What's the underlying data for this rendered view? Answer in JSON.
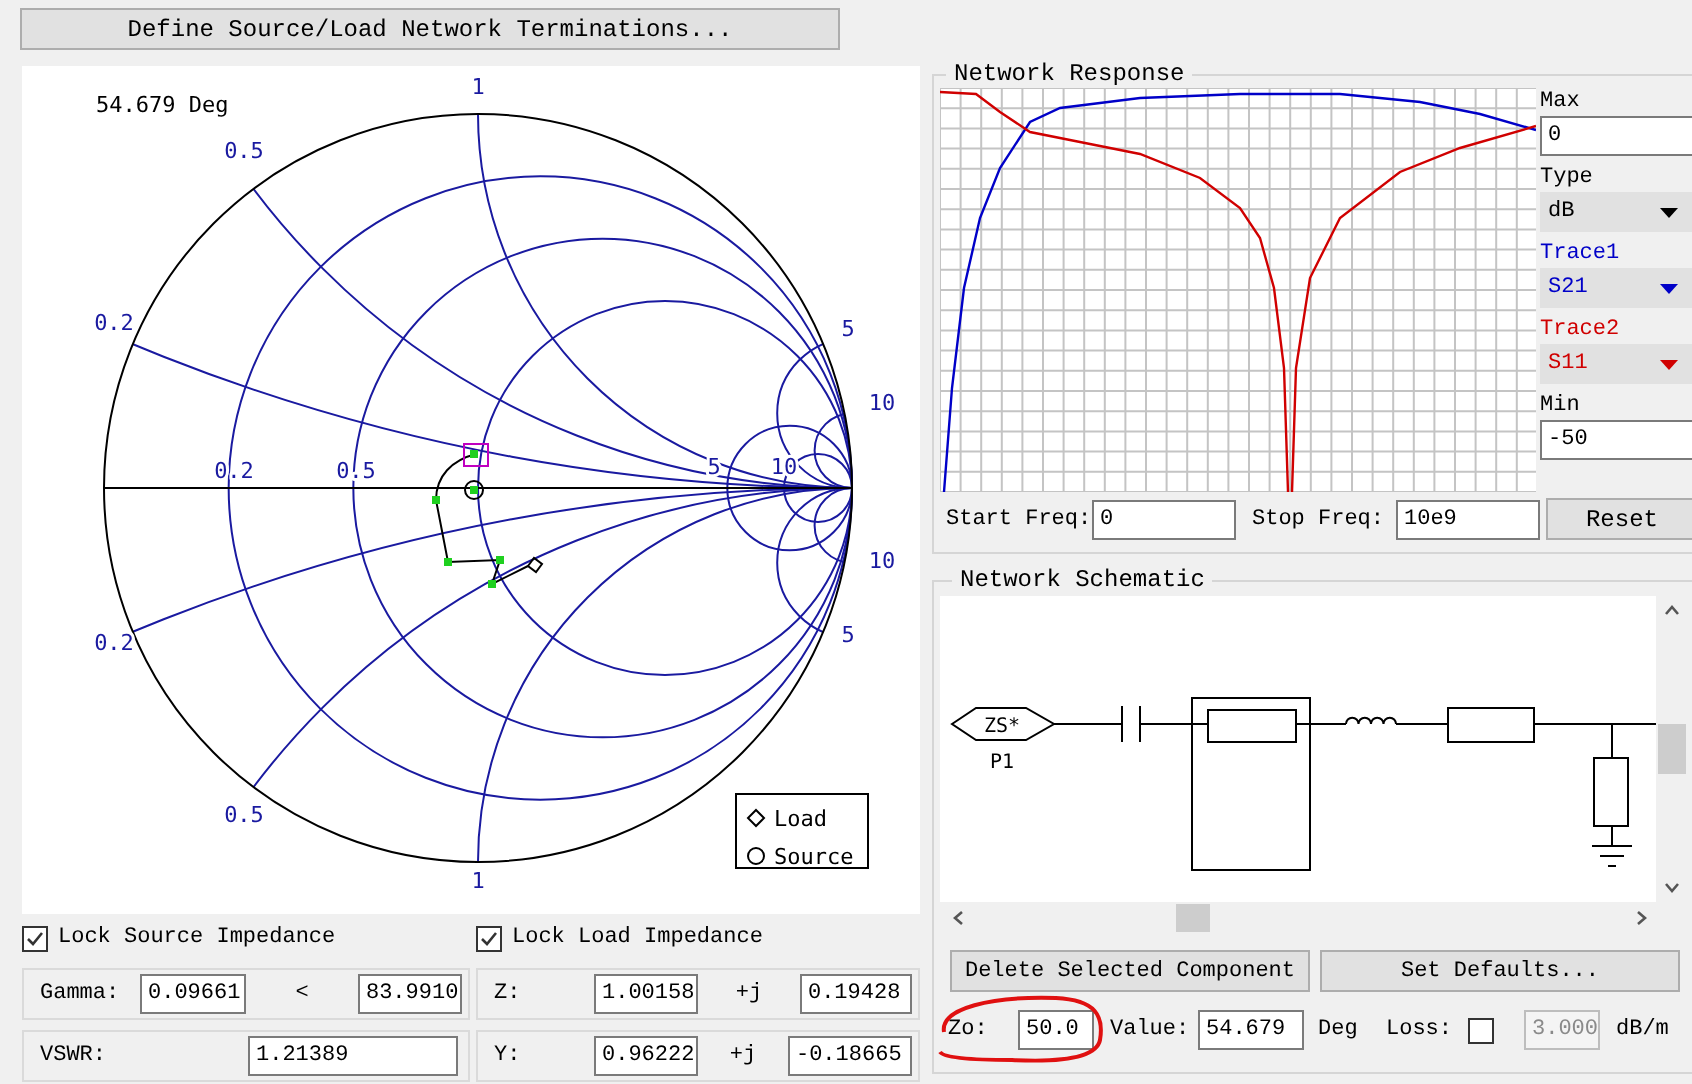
{
  "toolbar_button": "Define Source/Load Network Terminations...",
  "smith_chart": {
    "angle_readout": "54.679 Deg",
    "labels": [
      "1",
      "0.5",
      "0.2",
      "5",
      "10",
      "0.2",
      "0.5",
      "5",
      "10",
      "10",
      "5",
      "0.2",
      "0.5",
      "1"
    ],
    "legend": [
      {
        "kind": "diamond",
        "label": "Load"
      },
      {
        "kind": "circle",
        "label": "Source"
      }
    ]
  },
  "source": {
    "lock": {
      "label": "Lock Source Impedance",
      "checked": true
    },
    "gamma_label": "Gamma:",
    "gamma_mag": "0.09661",
    "angle_symbol": "<",
    "gamma_angle": "83.9910",
    "vswr_label": "VSWR:",
    "vswr": "1.21389"
  },
  "load": {
    "lock": {
      "label": "Lock Load Impedance",
      "checked": true
    },
    "z_label": "Z:",
    "z_real": "1.00158",
    "z_j": "+j",
    "z_imag": "0.19428",
    "y_label": "Y:",
    "y_real": "0.96222",
    "y_j": "+j",
    "y_imag": "-0.18665"
  },
  "network_response": {
    "title": "Network Response",
    "max_label": "Max",
    "max": "0",
    "type_label": "Type",
    "type": "dB",
    "traces": [
      {
        "label": "Trace1",
        "value": "S21",
        "color": "#0000c8"
      },
      {
        "label": "Trace2",
        "value": "S11",
        "color": "#d00000"
      }
    ],
    "min_label": "Min",
    "min": "-50",
    "start_label": "Start Freq:",
    "start": "0",
    "stop_label": "Stop Freq:",
    "stop": "10e9",
    "reset": "Reset"
  },
  "schematic": {
    "title": "Network Schematic",
    "port_symbol": "ZS*",
    "port_label": "P1"
  },
  "buttons": [
    "Delete Selected Component",
    "Set Defaults..."
  ],
  "properties": {
    "zo_label": "Zo:",
    "zo": "50.0",
    "zo_highlighted": true,
    "value_label": "Value:",
    "value": "54.679",
    "unit": "Deg",
    "loss_label": "Loss:",
    "loss_checked": false,
    "loss": "3.000",
    "loss_disabled": true,
    "loss_unit": "dB/m"
  }
}
